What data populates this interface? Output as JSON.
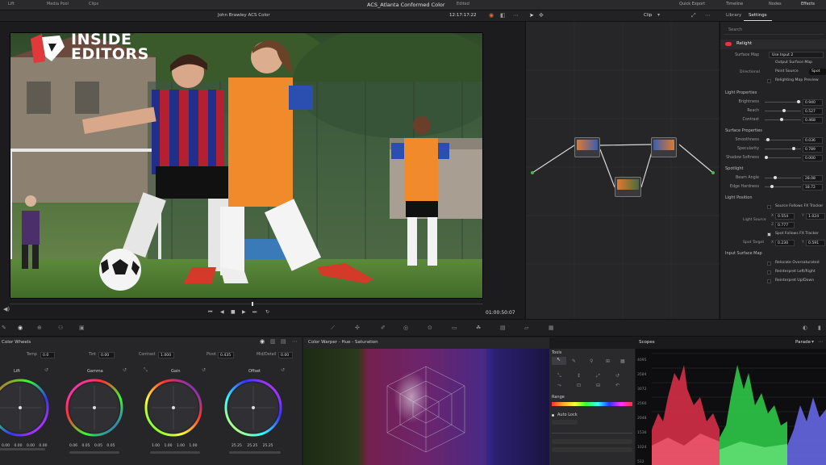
{
  "topbar": {
    "tabs": [
      "Lift",
      "Media Pool",
      "Clips"
    ],
    "project_title": "ACS_Atlanta Conformed Color",
    "edited_label": "Edited",
    "right_items": [
      "Quick Export",
      "Timeline",
      "Nodes",
      "Effects"
    ]
  },
  "viewer": {
    "lut_label": "John Brawley ACS Color",
    "timecode_top": "12:17:17:22",
    "clip_label": "Clip",
    "timecode_bottom": "01:00:50:07"
  },
  "logo": {
    "line1": "INSIDE",
    "line2": "EDITORS"
  },
  "settings": {
    "tab_library": "Library",
    "tab_settings": "Settings",
    "search_placeholder": "Search",
    "section_relight": "Relight",
    "surface_map_label": "Surface Map",
    "surface_map_value": "Use Input 2",
    "output_surface_map": "Output Surface Map",
    "directional_label": "Directional",
    "point_source_label": "Point Source",
    "spot_label": "Spot",
    "relight_preview": "Relighting Map Preview",
    "section_light_props": "Light Properties",
    "brightness_label": "Brightness",
    "brightness_value": "0.940",
    "reach_label": "Reach",
    "reach_value": "0.527",
    "contrast_label": "Contrast",
    "contrast_value": "0.468",
    "section_surface_props": "Surface Properties",
    "smoothness_label": "Smoothness",
    "smoothness_value": "0.036",
    "specularity_label": "Specularity",
    "specularity_value": "0.789",
    "shadow_softness_label": "Shadow Softness",
    "shadow_softness_value": "0.000",
    "section_spotlight": "Spotlight",
    "beam_angle_label": "Beam Angle",
    "beam_angle_value": "28.08",
    "edge_hardness_label": "Edge Hardness",
    "edge_hardness_value": "18.72",
    "section_light_position": "Light Position",
    "source_follows_fx": "Source Follows FX Tracker",
    "light_source_label": "Light Source",
    "light_source_x": "0.554",
    "light_source_y": "1.024",
    "light_source_z": "0.777",
    "spot_follows_fx": "Spot Follows FX Tracker",
    "spot_target_label": "Spot Target",
    "spot_target_x": "0.230",
    "spot_target_y": "0.591",
    "section_input_surface": "Input Surface Map",
    "relocate_oversaturated": "Relocate Oversaturated",
    "reinterpret_lr": "Reinterpret Left/Right",
    "reinterpret_ud": "Reinterpret Up/Down"
  },
  "wheels": {
    "title": "Color Wheels",
    "temp_label": "Temp",
    "temp_value": "0.0",
    "tint_label": "Tint",
    "tint_value": "0.00",
    "contrast_label": "Contrast",
    "contrast_value": "1.000",
    "pivot_label": "Pivot",
    "pivot_value": "0.435",
    "middetail_label": "Mid/Detail",
    "middetail_value": "0.00",
    "lift_label": "Lift",
    "lift_values": [
      "0.00",
      "0.00",
      "0.00",
      "0.00"
    ],
    "gamma_label": "Gamma",
    "gamma_values": [
      "0.06",
      "0.05",
      "0.05",
      "0.05"
    ],
    "gain_label": "Gain",
    "gain_values": [
      "1.00",
      "1.00",
      "1.00",
      "1.00"
    ],
    "offset_label": "Offset",
    "offset_values": [
      "25.25",
      "25.25",
      "25.25"
    ]
  },
  "warper": {
    "title": "Color Warper - Hue - Saturation",
    "tools_label": "Tools",
    "range_label": "Range",
    "auto_lock_label": "Auto Lock"
  },
  "scopes": {
    "title": "Scopes",
    "mode": "Parade",
    "ticks": [
      "4095",
      "3584",
      "3072",
      "2560",
      "2048",
      "1536",
      "1024",
      "512"
    ]
  },
  "colors": {
    "accent_red": "#e0383b",
    "scope_red": "#e0304a",
    "scope_green": "#2fd14a",
    "scope_blue": "#6a6cf0"
  }
}
